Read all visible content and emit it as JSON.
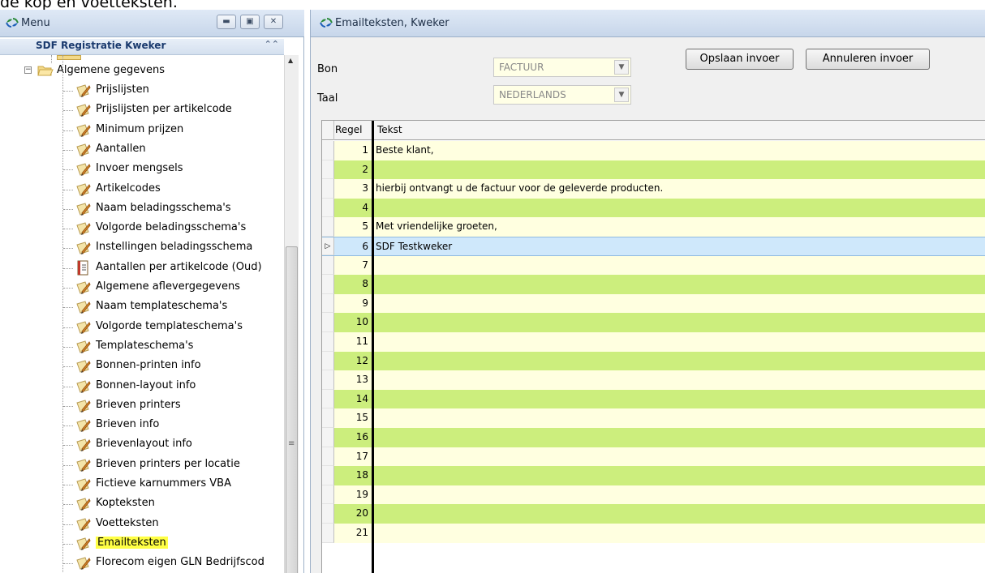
{
  "caption": "de kop en voetteksten.",
  "menu": {
    "title": "Menu",
    "section": "SDF Registratie Kweker",
    "group": "Algemene gegevens",
    "items": [
      {
        "label": "Prijslijsten",
        "icon": "pencil-doc-icon"
      },
      {
        "label": "Prijslijsten per artikelcode",
        "icon": "pencil-doc-icon"
      },
      {
        "label": "Minimum prijzen",
        "icon": "pencil-doc-icon"
      },
      {
        "label": "Aantallen",
        "icon": "pencil-doc-icon"
      },
      {
        "label": "Invoer mengsels",
        "icon": "pencil-doc-icon"
      },
      {
        "label": "Artikelcodes",
        "icon": "pencil-doc-icon"
      },
      {
        "label": "Naam beladingsschema's",
        "icon": "pencil-doc-icon"
      },
      {
        "label": "Volgorde beladingsschema's",
        "icon": "pencil-doc-icon"
      },
      {
        "label": "Instellingen beladingsschema",
        "icon": "pencil-doc-icon"
      },
      {
        "label": "Aantallen per artikelcode (Oud)",
        "icon": "form-doc-icon"
      },
      {
        "label": "Algemene aflevergegevens",
        "icon": "pencil-doc-icon"
      },
      {
        "label": "Naam templateschema's",
        "icon": "pencil-doc-icon"
      },
      {
        "label": "Volgorde templateschema's",
        "icon": "pencil-doc-icon"
      },
      {
        "label": "Templateschema's",
        "icon": "pencil-doc-icon"
      },
      {
        "label": "Bonnen-printen info",
        "icon": "pencil-doc-icon"
      },
      {
        "label": "Bonnen-layout info",
        "icon": "pencil-doc-icon"
      },
      {
        "label": "Brieven printers",
        "icon": "pencil-doc-icon"
      },
      {
        "label": "Brieven info",
        "icon": "pencil-doc-icon"
      },
      {
        "label": "Brievenlayout info",
        "icon": "pencil-doc-icon"
      },
      {
        "label": "Brieven printers per locatie",
        "icon": "pencil-doc-icon"
      },
      {
        "label": "Fictieve karnummers VBA",
        "icon": "pencil-doc-icon"
      },
      {
        "label": "Kopteksten",
        "icon": "pencil-doc-icon"
      },
      {
        "label": "Voetteksten",
        "icon": "pencil-doc-icon"
      },
      {
        "label": "Emailteksten",
        "icon": "pencil-doc-icon",
        "highlighted": true
      },
      {
        "label": "Florecom eigen GLN Bedrijfscod",
        "icon": "pencil-doc-icon"
      }
    ]
  },
  "window": {
    "title": "Emailteksten, Kweker",
    "fields": {
      "bon_label": "Bon",
      "bon_value": "FACTUUR",
      "taal_label": "Taal",
      "taal_value": "NEDERLANDS"
    },
    "buttons": {
      "save": "Opslaan invoer",
      "cancel": "Annuleren invoer"
    },
    "grid": {
      "columns": [
        "Regel",
        "Tekst"
      ],
      "current_row": 6,
      "rows": [
        {
          "regel": "1",
          "tekst": "Beste klant,"
        },
        {
          "regel": "2",
          "tekst": ""
        },
        {
          "regel": "3",
          "tekst": "hierbij ontvangt u de factuur voor de geleverde producten."
        },
        {
          "regel": "4",
          "tekst": ""
        },
        {
          "regel": "5",
          "tekst": "Met vriendelijke groeten,"
        },
        {
          "regel": "6",
          "tekst": "SDF Testkweker"
        },
        {
          "regel": "7",
          "tekst": ""
        },
        {
          "regel": "8",
          "tekst": ""
        },
        {
          "regel": "9",
          "tekst": ""
        },
        {
          "regel": "10",
          "tekst": ""
        },
        {
          "regel": "11",
          "tekst": ""
        },
        {
          "regel": "12",
          "tekst": ""
        },
        {
          "regel": "13",
          "tekst": ""
        },
        {
          "regel": "14",
          "tekst": ""
        },
        {
          "regel": "15",
          "tekst": ""
        },
        {
          "regel": "16",
          "tekst": ""
        },
        {
          "regel": "17",
          "tekst": ""
        },
        {
          "regel": "18",
          "tekst": ""
        },
        {
          "regel": "19",
          "tekst": ""
        },
        {
          "regel": "20",
          "tekst": ""
        },
        {
          "regel": "21",
          "tekst": ""
        }
      ]
    }
  },
  "colors": {
    "row_odd": "#ffffe0",
    "row_even": "#ccee7d",
    "row_current": "#cfe8fb",
    "highlight": "#ffff44"
  }
}
